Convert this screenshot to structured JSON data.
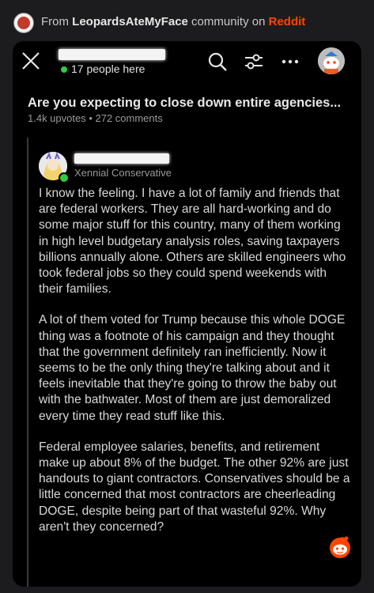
{
  "source": {
    "prefix": "From ",
    "community": "LeopardsAteMyFace",
    "middle": " community on ",
    "platform": "Reddit"
  },
  "header": {
    "online_count": "17 people here"
  },
  "post": {
    "title": "Are you expecting to close down entire agencies...",
    "meta": "1.4k upvotes • 272 comments"
  },
  "comment": {
    "flair": "Xennial Conservative",
    "paragraphs": [
      "I know the feeling. I have a lot of family and friends that are federal workers. They are all hard-working and do some major stuff for this country, many of them working in high level budgetary analysis roles, saving taxpayers billions annually alone. Others are skilled engineers who took federal jobs so they could spend weekends with their families.",
      "A lot of them voted for Trump because this whole DOGE thing was a footnote of his campaign and they thought that the government definitely ran inefficiently. Now it seems to be the only thing they're talking about and it feels inevitable that they're going to throw the baby out with the bathwater. Most of them are just demoralized every time they read stuff like this.",
      "Federal employee salaries, benefits, and retirement make up about 8% of the budget. The other 92% are just handouts to giant contractors. Conservatives should be a little concerned that most contractors are cheerleading DOGE, despite being part of that wasteful 92%. Why aren't they concerned?"
    ]
  },
  "colors": {
    "reddit_orange": "#ff4500",
    "online_green": "#2ecc40"
  }
}
